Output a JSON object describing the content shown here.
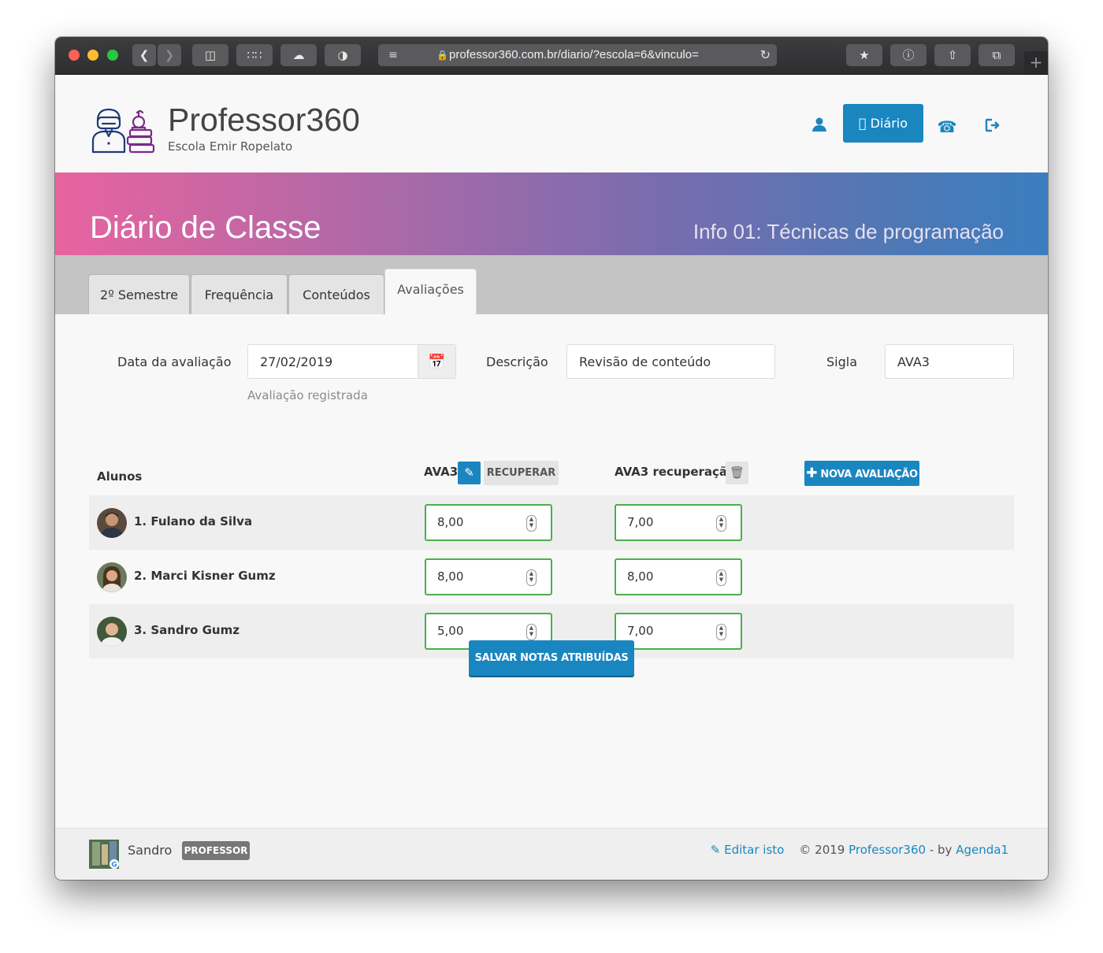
{
  "browser": {
    "url": "professor360.com.br/diario/?escola=6&vinculo="
  },
  "header": {
    "brand": "Professor360",
    "school": "Escola Emir Ropelato",
    "diario_button": "Diário"
  },
  "banner": {
    "title": "Diário de Classe",
    "subtitle": "Info 01: Técnicas de programação"
  },
  "tabs": [
    {
      "label": "2º Semestre",
      "active": false
    },
    {
      "label": "Frequência",
      "active": false
    },
    {
      "label": "Conteúdos",
      "active": false
    },
    {
      "label": "Avaliações",
      "active": true
    }
  ],
  "form": {
    "date_label": "Data da avaliação",
    "date_value": "27/02/2019",
    "date_help": "Avaliação registrada",
    "description_label": "Descrição",
    "description_value": "Revisão de conteúdo",
    "sigla_label": "Sigla",
    "sigla_value": "AVA3"
  },
  "grades_table": {
    "students_header": "Alunos",
    "col1_header": "AVA3",
    "recuperar_button": "RECUPERAR",
    "col2_header": "AVA3 recuperação",
    "nova_avaliacao_button": "NOVA AVALIAÇÃO",
    "rows": [
      {
        "name": "1. Fulano da Silva",
        "grade": "8,00",
        "recovery": "7,00"
      },
      {
        "name": "2. Marci Kisner Gumz",
        "grade": "8,00",
        "recovery": "8,00"
      },
      {
        "name": "3. Sandro Gumz",
        "grade": "5,00",
        "recovery": "7,00"
      }
    ],
    "save_button": "SALVAR NOTAS ATRIBUÍDAS"
  },
  "footer": {
    "user": "Sandro",
    "role_badge": "PROFESSOR",
    "edit_link": "Editar isto",
    "copyright": "© 2019",
    "brand_link": "Professor360",
    "by_text": "- by",
    "agency_link": "Agenda1"
  },
  "colors": {
    "primary": "#1a86c0",
    "success_border": "#4cae4c",
    "banner_start": "#e8639f",
    "banner_end": "#3a7ec0"
  }
}
